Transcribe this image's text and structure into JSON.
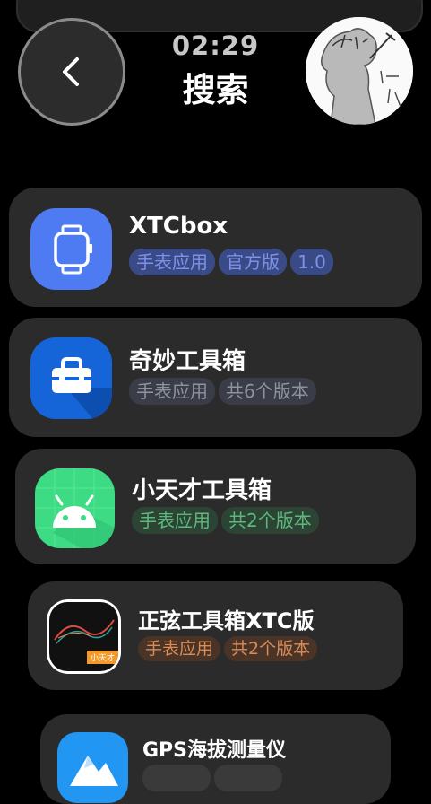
{
  "header": {
    "time": "02:29",
    "title": "搜索"
  },
  "results": [
    {
      "name": "XTCbox",
      "icon": "watch-icon",
      "tags": [
        "手表应用",
        "官方版",
        "1.0"
      ],
      "tag_color": "#3a4a86",
      "tag_text_color": "#7d92e6",
      "icon_bg": "#4e7bf2"
    },
    {
      "name": "奇妙工具箱",
      "icon": "toolbox-icon",
      "tags": [
        "手表应用",
        "共6个版本"
      ],
      "tag_color": "#3a3d47",
      "tag_text_color": "#8d939f",
      "icon_bg": "#1565d8"
    },
    {
      "name": "小天才工具箱",
      "icon": "android-icon",
      "tags": [
        "手表应用",
        "共2个版本"
      ],
      "tag_color": "#2c4434",
      "tag_text_color": "#5fb77d",
      "icon_bg": "#3ddc84"
    },
    {
      "name": "正弦工具箱XTC版",
      "icon": "sine-wave-icon",
      "icon_badge": "小天才",
      "tags": [
        "手表应用",
        "共2个版本"
      ],
      "tag_color": "#4a3327",
      "tag_text_color": "#d98c57",
      "icon_bg": "#111111"
    },
    {
      "name": "GPS海拔测量仪",
      "icon": "mountain-icon",
      "tags": [],
      "tag_color": "#3a3a3a",
      "tag_text_color": "#999999",
      "icon_bg": "#2196f3"
    }
  ]
}
